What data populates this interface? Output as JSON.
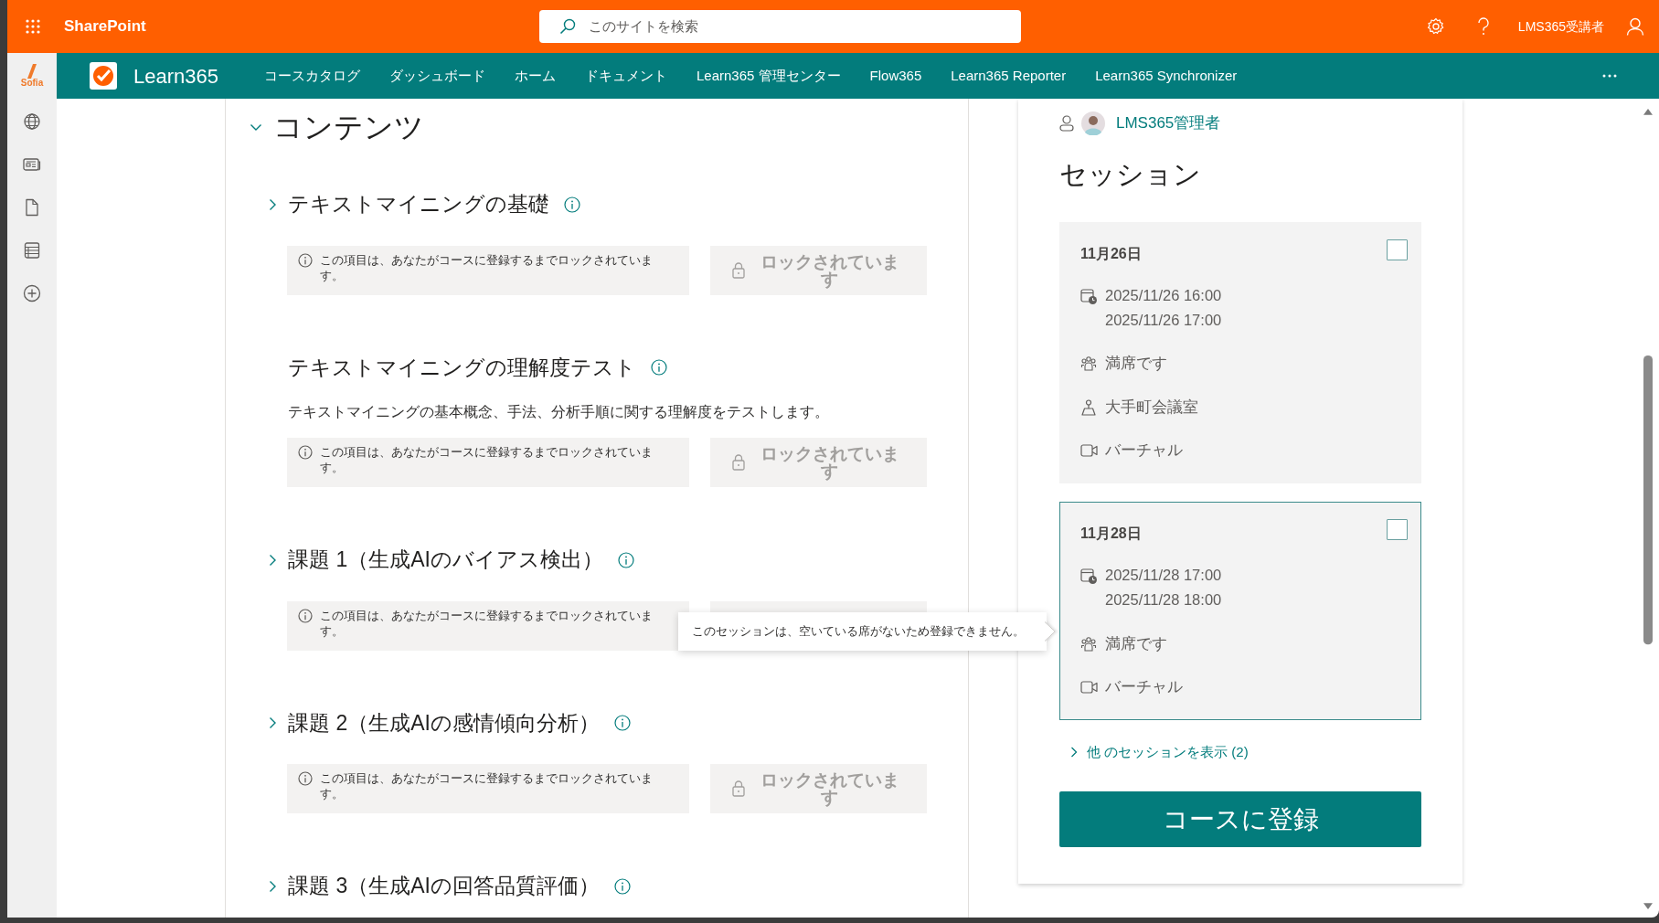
{
  "suite_bar": {
    "app_name": "SharePoint",
    "search": {
      "placeholder": "このサイトを検索"
    },
    "user_name": "LMS365受講者"
  },
  "app_bar": {
    "logo_text": "Sofia"
  },
  "site_nav": {
    "site_title": "Learn365",
    "links": [
      {
        "label": "コースカタログ"
      },
      {
        "label": "ダッシュボード"
      },
      {
        "label": "ホーム"
      },
      {
        "label": "ドキュメント"
      },
      {
        "label": "Learn365 管理センター"
      },
      {
        "label": "Flow365"
      },
      {
        "label": "Learn365 Reporter"
      },
      {
        "label": "Learn365 Synchronizer"
      }
    ]
  },
  "contents": {
    "title": "コンテンツ",
    "expanded": true,
    "items": [
      {
        "kind": "module",
        "expanded": false,
        "title": "テキストマイニングの基礎",
        "lock_notice": "この項目は、あなたがコースに登録するまでロックされています。",
        "lock_button": "ロックされています"
      },
      {
        "kind": "quiz",
        "title": "テキストマイニングの理解度テスト",
        "description": "テキストマイニングの基本概念、手法、分析手順に関する理解度をテストします。",
        "lock_notice": "この項目は、あなたがコースに登録するまでロックされています。",
        "lock_button": "ロックされています"
      },
      {
        "kind": "module",
        "expanded": false,
        "title": "課題 1（生成AIのバイアス検出）",
        "lock_notice": "この項目は、あなたがコースに登録するまでロックされています。",
        "lock_button_covered": true
      },
      {
        "kind": "module",
        "expanded": false,
        "title": "課題 2（生成AIの感情傾向分析）",
        "lock_notice": "この項目は、あなたがコースに登録するまでロックされています。",
        "lock_button": "ロックされています"
      },
      {
        "kind": "module",
        "expanded": false,
        "title": "課題 3（生成AIの回答品質評価）"
      }
    ]
  },
  "tooltip": {
    "text": "このセッションは、空いている席がないため登録できません。"
  },
  "sessions_panel": {
    "instructor": "LMS365管理者",
    "title": "セッション",
    "sessions": [
      {
        "date": "11月26日",
        "checked": false,
        "hovered": false,
        "start": "2025/11/26 16:00",
        "end": "2025/11/26 17:00",
        "seats": "満席です",
        "location": "大手町会議室",
        "venue": "バーチャル"
      },
      {
        "date": "11月28日",
        "checked": false,
        "hovered": true,
        "start": "2025/11/28 17:00",
        "end": "2025/11/28 18:00",
        "seats": "満席です",
        "venue": "バーチャル"
      }
    ],
    "more_link": "他 のセッションを表示 (2)",
    "register_button": "コースに登録"
  }
}
